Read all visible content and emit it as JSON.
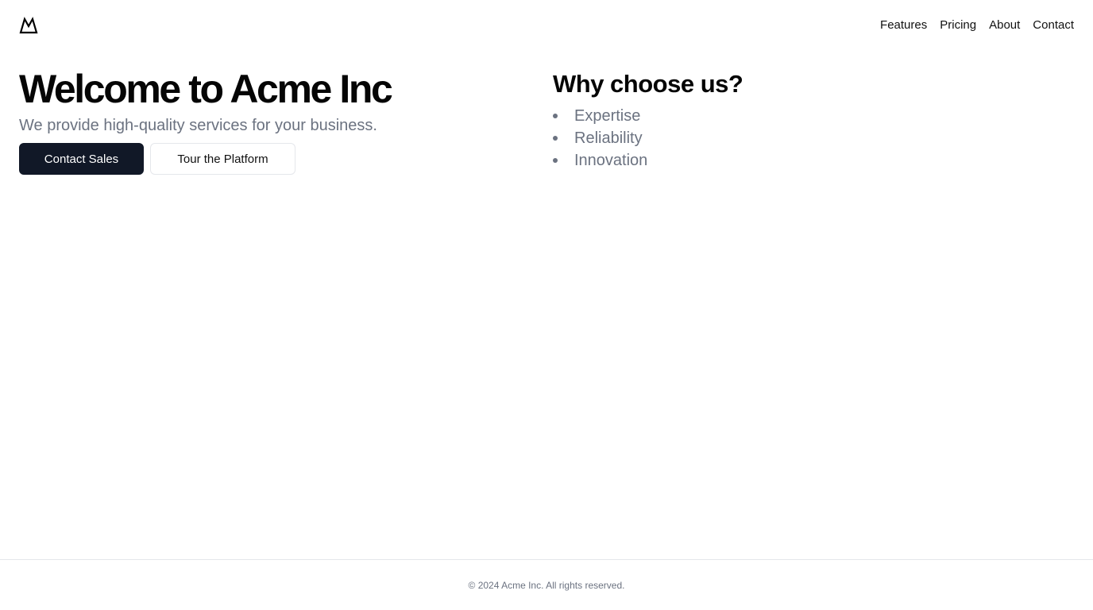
{
  "header": {
    "logo_icon": "mountain-icon",
    "nav": [
      {
        "label": "Features"
      },
      {
        "label": "Pricing"
      },
      {
        "label": "About"
      },
      {
        "label": "Contact"
      }
    ]
  },
  "hero": {
    "title": "Welcome to Acme Inc",
    "subtitle": "We provide high-quality services for your business.",
    "primary_button": "Contact Sales",
    "secondary_button": "Tour the Platform"
  },
  "why": {
    "title": "Why choose us?",
    "items": [
      "Expertise",
      "Reliability",
      "Innovation"
    ]
  },
  "footer": {
    "text": "© 2024 Acme Inc. All rights reserved."
  },
  "colors": {
    "primary_button_bg": "#111827",
    "muted_text": "#6b7280",
    "border": "#e5e7eb"
  }
}
